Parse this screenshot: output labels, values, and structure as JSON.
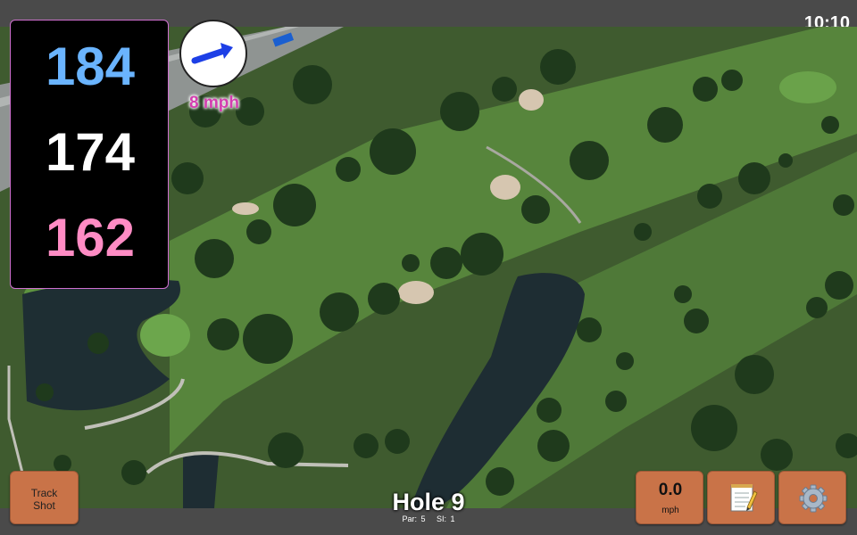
{
  "status": {
    "time": "10:10"
  },
  "distances": {
    "back": "184",
    "middle": "174",
    "front": "162"
  },
  "wind": {
    "label": "8 mph",
    "direction_icon": "blue-arrow-icon",
    "arrow_color": "#1d3fe6"
  },
  "hole": {
    "title": "Hole 9",
    "par": "Par: 5",
    "si": "SI: 1"
  },
  "buttons": {
    "track_line1": "Track",
    "track_line2": "Shot",
    "wind_value": "0.0",
    "wind_unit": "mph",
    "notes_icon": "notepad-icon",
    "settings_icon": "gear-icon"
  },
  "colors": {
    "back": "#6ab4ff",
    "middle": "#ffffff",
    "front": "#ff8cc4",
    "button": "#c97348",
    "wind_text": "#d43fb0"
  }
}
